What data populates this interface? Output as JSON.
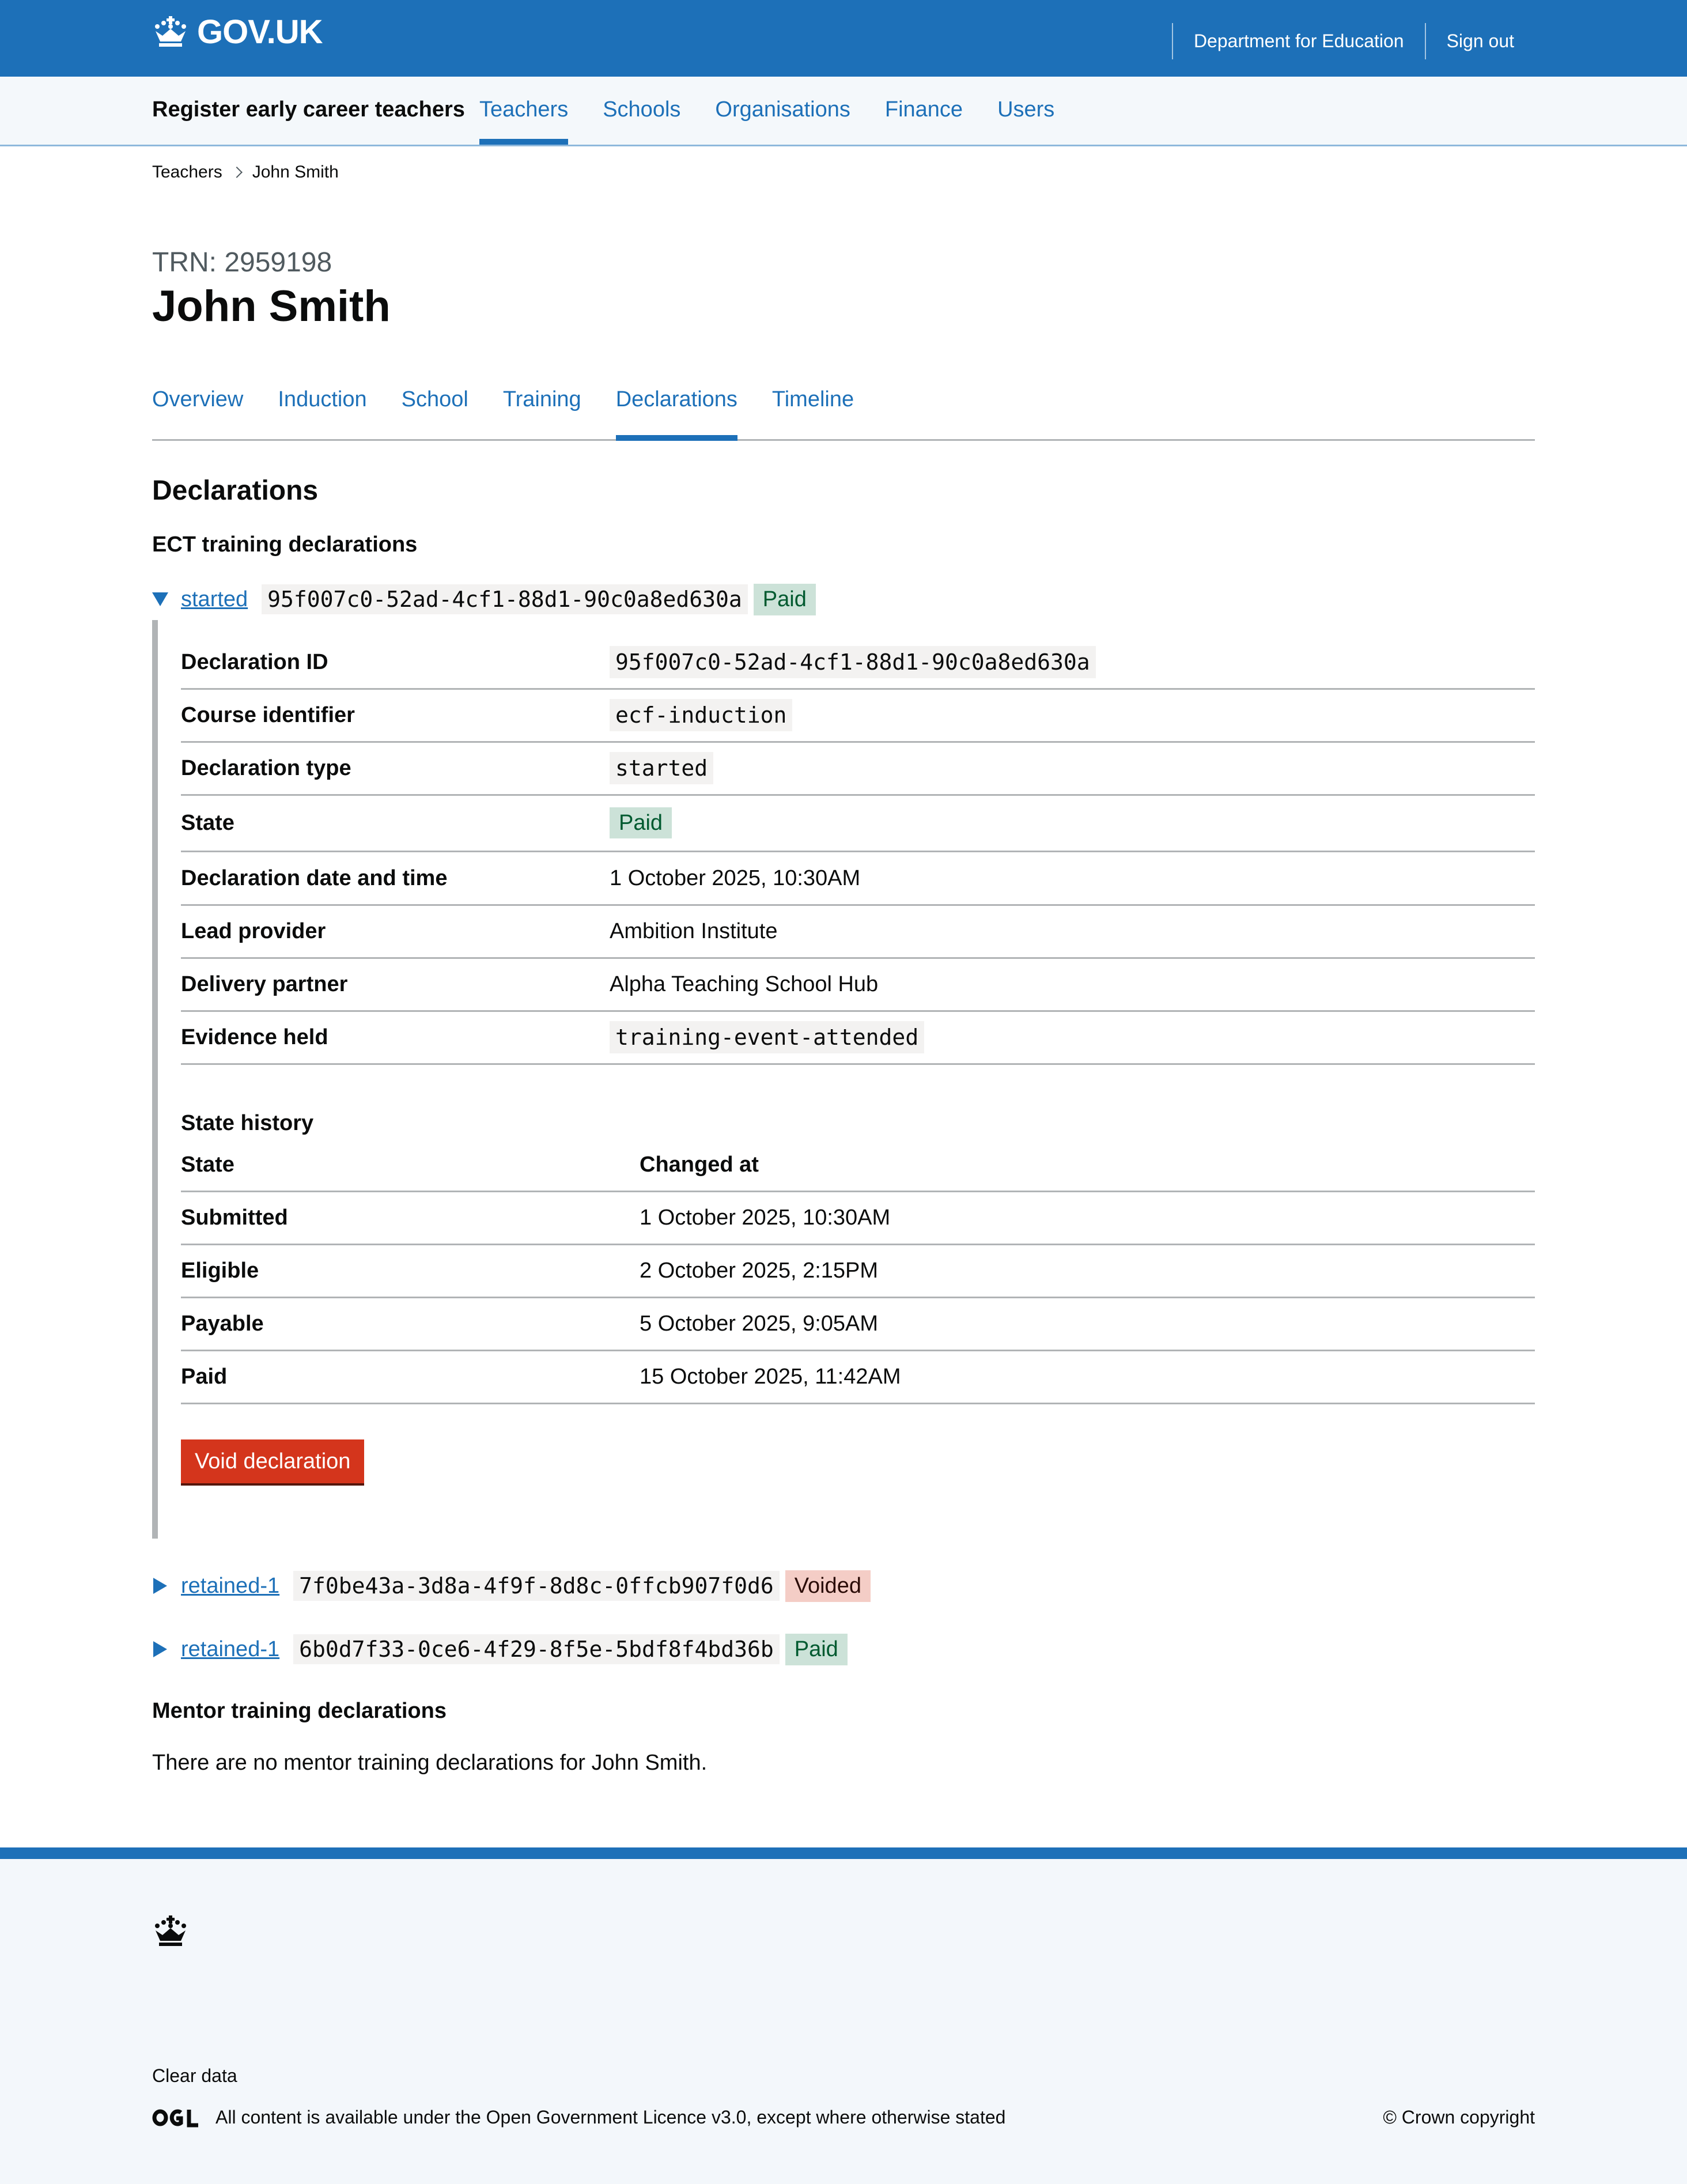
{
  "header": {
    "logo_text": "GOV.UK",
    "nav": [
      "Department for Education",
      "Sign out"
    ]
  },
  "service": {
    "name": "Register early career teachers",
    "nav": [
      "Teachers",
      "Schools",
      "Organisations",
      "Finance",
      "Users"
    ],
    "active": "Teachers"
  },
  "breadcrumb": {
    "parent": "Teachers",
    "current": "John Smith"
  },
  "teacher": {
    "trn": "TRN: 2959198",
    "name": "John Smith"
  },
  "subnav": {
    "items": [
      "Overview",
      "Induction",
      "School",
      "Training",
      "Declarations",
      "Timeline"
    ],
    "active": "Declarations"
  },
  "page": {
    "heading": "Declarations",
    "ect_heading": "ECT training declarations",
    "mentor_heading": "Mentor training declarations",
    "mentor_empty": "There are no mentor training declarations for John Smith."
  },
  "declarations": [
    {
      "type": "started",
      "id": "95f007c0-52ad-4cf1-88d1-90c0a8ed630a",
      "status": "Paid",
      "expanded": true,
      "details": {
        "labels": {
          "id": "Declaration ID",
          "course": "Course identifier",
          "type": "Declaration type",
          "state": "State",
          "date": "Declaration date and time",
          "lead_provider": "Lead provider",
          "delivery_partner": "Delivery partner",
          "evidence": "Evidence held"
        },
        "course": "ecf-induction",
        "date": "1 October 2025, 10:30AM",
        "lead_provider": "Ambition Institute",
        "delivery_partner": "Alpha Teaching School Hub",
        "evidence": "training-event-attended"
      },
      "history": {
        "heading": "State history",
        "columns": [
          "State",
          "Changed at"
        ],
        "rows": [
          {
            "state": "Submitted",
            "changed_at": "1 October 2025, 10:30AM"
          },
          {
            "state": "Eligible",
            "changed_at": "2 October 2025, 2:15PM"
          },
          {
            "state": "Payable",
            "changed_at": "5 October 2025, 9:05AM"
          },
          {
            "state": "Paid",
            "changed_at": "15 October 2025, 11:42AM"
          }
        ]
      },
      "void_label": "Void declaration"
    },
    {
      "type": "retained-1",
      "id": "7f0be43a-3d8a-4f9f-8d8c-0ffcb907f0d6",
      "status": "Voided",
      "expanded": false
    },
    {
      "type": "retained-1",
      "id": "6b0d7f33-0ce6-4f29-8f5e-5bdf8f4bd36b",
      "status": "Paid",
      "expanded": false
    }
  ],
  "footer": {
    "clear_data": "Clear data",
    "licence_prefix": "All content is available under the ",
    "licence_link": "Open Government Licence v3.0",
    "licence_suffix": ", except where otherwise stated",
    "copyright": "© Crown copyright"
  },
  "colors": {
    "brand": "#1d70b8",
    "paid_bg": "#cce2d8",
    "voided_bg": "#f4cdc6",
    "warning_button": "#d4351c"
  },
  "icons": [
    "crown-icon",
    "chevron-right-icon",
    "triangle-down-icon",
    "triangle-right-icon",
    "ogl-logo"
  ]
}
